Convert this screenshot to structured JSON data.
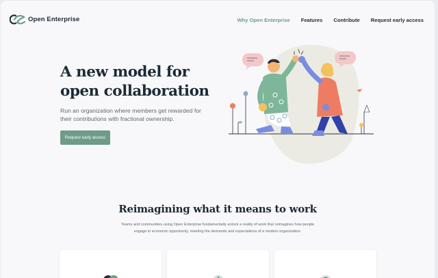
{
  "brand": {
    "name": "Open Enterprise"
  },
  "nav": {
    "links": [
      {
        "label": "Why Open Enterprise",
        "active": true
      },
      {
        "label": "Features",
        "active": false
      },
      {
        "label": "Contribute",
        "active": false
      },
      {
        "label": "Request early access",
        "active": false
      }
    ]
  },
  "hero": {
    "title_line1": "A new model for",
    "title_line2": "open collaboration",
    "subtitle": "Run an organization where members get rewarded for their contributions with fractional ownership.",
    "cta_label": "Request early access"
  },
  "section": {
    "title": "Reimagining what it means to work",
    "text": "Teams and communities using Open Enterprise fundamentally unlock a reality of work that reimagines how people engage in economic opportunity, meeting the demands and expectations of a modern organization."
  },
  "cards": [
    {
      "icon": "people-icon"
    },
    {
      "icon": "tree-icon"
    },
    {
      "icon": "badge-icon"
    }
  ],
  "colors": {
    "accent": "#6f9b89",
    "text_dark": "#1c2b36",
    "text_muted": "#5d6870",
    "background": "#f8f8fa"
  }
}
